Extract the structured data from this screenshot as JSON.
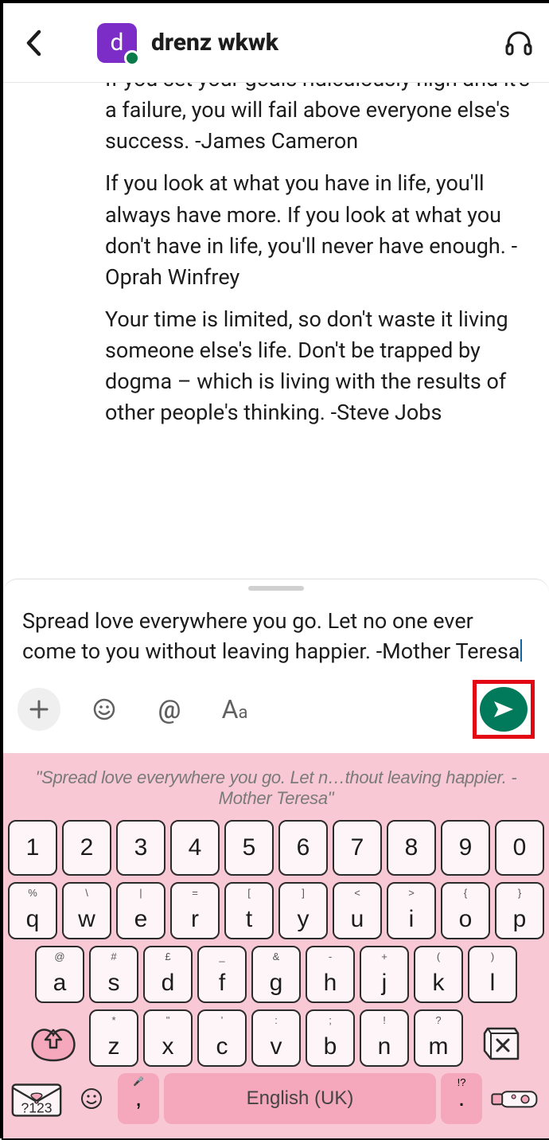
{
  "header": {
    "contact_name": "drenz wkwk",
    "avatar_letter": "d"
  },
  "messages": [
    "If you set your goals ridiculously high and it's a failure, you will fail above everyone else's success. -James Cameron",
    "If you look at what you have in life, you'll always have more. If you look at what you don't have in life, you'll never have enough. -Oprah Winfrey",
    "Your time is limited, so don't waste it living someone else's life. Don't be trapped by dogma – which is living with the results of other people's thinking. -Steve Jobs"
  ],
  "composer": {
    "draft_text": "Spread love everywhere you go. Let no one ever come to you without leaving happier. -Mother Teresa"
  },
  "keyboard": {
    "suggestion": "\"Spread love everywhere you go. Let n…thout leaving happier. -Mother Teresa\"",
    "row_numbers": [
      "1",
      "2",
      "3",
      "4",
      "5",
      "6",
      "7",
      "8",
      "9",
      "0"
    ],
    "row_qwerty": [
      {
        "m": "q",
        "a": "%"
      },
      {
        "m": "w",
        "a": "\\"
      },
      {
        "m": "e",
        "a": "|"
      },
      {
        "m": "r",
        "a": "="
      },
      {
        "m": "t",
        "a": "["
      },
      {
        "m": "y",
        "a": "]"
      },
      {
        "m": "u",
        "a": "<"
      },
      {
        "m": "i",
        "a": ">"
      },
      {
        "m": "o",
        "a": "{"
      },
      {
        "m": "p",
        "a": "}"
      }
    ],
    "row_asdf": [
      {
        "m": "a",
        "a": "@"
      },
      {
        "m": "s",
        "a": "#"
      },
      {
        "m": "d",
        "a": "£"
      },
      {
        "m": "f",
        "a": "_"
      },
      {
        "m": "g",
        "a": "&"
      },
      {
        "m": "h",
        "a": "-"
      },
      {
        "m": "j",
        "a": "+"
      },
      {
        "m": "k",
        "a": "("
      },
      {
        "m": "l",
        "a": ")"
      }
    ],
    "row_zxcv": [
      {
        "m": "z",
        "a": "*"
      },
      {
        "m": "x",
        "a": "\""
      },
      {
        "m": "c",
        "a": "'"
      },
      {
        "m": "v",
        "a": ":"
      },
      {
        "m": "b",
        "a": ";"
      },
      {
        "m": "n",
        "a": "!"
      },
      {
        "m": "m",
        "a": "?"
      }
    ],
    "symbols_label": "?123",
    "space_label": "English (UK)",
    "comma": {
      "m": ",",
      "a": "🎤"
    },
    "period": {
      "m": ".",
      "a": "!?"
    }
  }
}
